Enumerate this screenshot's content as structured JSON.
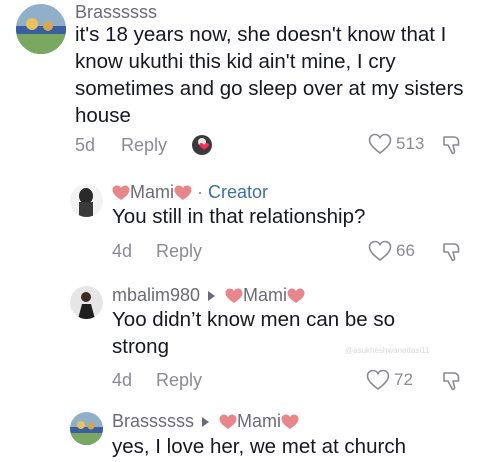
{
  "comments": [
    {
      "username": "Brassssss",
      "text": "it's 18 years now, she doesn't know that I know ukuthi this kid ain't mine, I cry sometimes and go sleep over at my sisters house",
      "age": "5d",
      "reply_label": "Reply",
      "likes": "513"
    },
    {
      "username": "Mami",
      "creator_separator": "·",
      "creator_label": "Creator",
      "text": "You still in that relationship?",
      "age": "4d",
      "reply_label": "Reply",
      "likes": "66"
    },
    {
      "username": "mbalim980",
      "reply_to": "Mami",
      "text": "Yoo didn’t know men can be so strong",
      "age": "4d",
      "reply_label": "Reply",
      "likes": "72",
      "watermark": "@asukheshwanedasi11"
    },
    {
      "username": "Brassssss",
      "reply_to": "Mami",
      "text": "yes, I love her, we met at church"
    }
  ],
  "colors": {
    "text": "#161823",
    "muted": "#8a8b91",
    "creator": "#3a6fa8",
    "heart_emoji": "#e8868a"
  },
  "icons": [
    "heart-outline-icon",
    "dislike-icon",
    "heart-emoji-icon",
    "reply-arrow-icon"
  ]
}
